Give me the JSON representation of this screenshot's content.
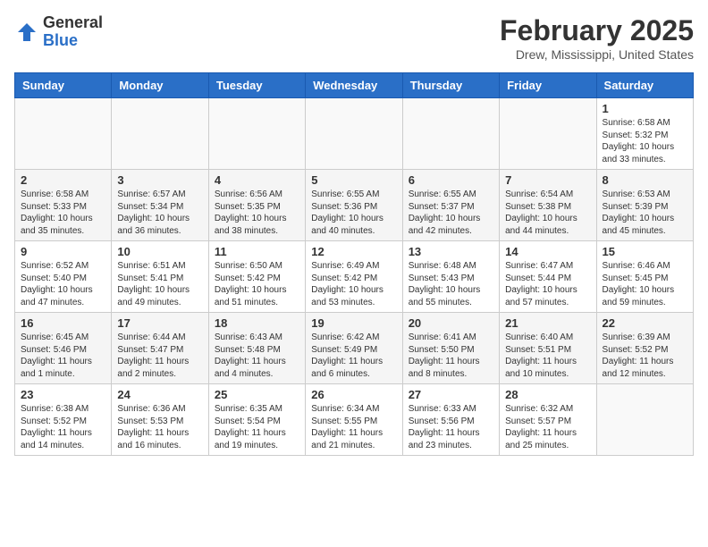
{
  "header": {
    "logo_general": "General",
    "logo_blue": "Blue",
    "title": "February 2025",
    "location": "Drew, Mississippi, United States"
  },
  "weekdays": [
    "Sunday",
    "Monday",
    "Tuesday",
    "Wednesday",
    "Thursday",
    "Friday",
    "Saturday"
  ],
  "weeks": [
    [
      {
        "day": "",
        "info": ""
      },
      {
        "day": "",
        "info": ""
      },
      {
        "day": "",
        "info": ""
      },
      {
        "day": "",
        "info": ""
      },
      {
        "day": "",
        "info": ""
      },
      {
        "day": "",
        "info": ""
      },
      {
        "day": "1",
        "info": "Sunrise: 6:58 AM\nSunset: 5:32 PM\nDaylight: 10 hours and 33 minutes."
      }
    ],
    [
      {
        "day": "2",
        "info": "Sunrise: 6:58 AM\nSunset: 5:33 PM\nDaylight: 10 hours and 35 minutes."
      },
      {
        "day": "3",
        "info": "Sunrise: 6:57 AM\nSunset: 5:34 PM\nDaylight: 10 hours and 36 minutes."
      },
      {
        "day": "4",
        "info": "Sunrise: 6:56 AM\nSunset: 5:35 PM\nDaylight: 10 hours and 38 minutes."
      },
      {
        "day": "5",
        "info": "Sunrise: 6:55 AM\nSunset: 5:36 PM\nDaylight: 10 hours and 40 minutes."
      },
      {
        "day": "6",
        "info": "Sunrise: 6:55 AM\nSunset: 5:37 PM\nDaylight: 10 hours and 42 minutes."
      },
      {
        "day": "7",
        "info": "Sunrise: 6:54 AM\nSunset: 5:38 PM\nDaylight: 10 hours and 44 minutes."
      },
      {
        "day": "8",
        "info": "Sunrise: 6:53 AM\nSunset: 5:39 PM\nDaylight: 10 hours and 45 minutes."
      }
    ],
    [
      {
        "day": "9",
        "info": "Sunrise: 6:52 AM\nSunset: 5:40 PM\nDaylight: 10 hours and 47 minutes."
      },
      {
        "day": "10",
        "info": "Sunrise: 6:51 AM\nSunset: 5:41 PM\nDaylight: 10 hours and 49 minutes."
      },
      {
        "day": "11",
        "info": "Sunrise: 6:50 AM\nSunset: 5:42 PM\nDaylight: 10 hours and 51 minutes."
      },
      {
        "day": "12",
        "info": "Sunrise: 6:49 AM\nSunset: 5:42 PM\nDaylight: 10 hours and 53 minutes."
      },
      {
        "day": "13",
        "info": "Sunrise: 6:48 AM\nSunset: 5:43 PM\nDaylight: 10 hours and 55 minutes."
      },
      {
        "day": "14",
        "info": "Sunrise: 6:47 AM\nSunset: 5:44 PM\nDaylight: 10 hours and 57 minutes."
      },
      {
        "day": "15",
        "info": "Sunrise: 6:46 AM\nSunset: 5:45 PM\nDaylight: 10 hours and 59 minutes."
      }
    ],
    [
      {
        "day": "16",
        "info": "Sunrise: 6:45 AM\nSunset: 5:46 PM\nDaylight: 11 hours and 1 minute."
      },
      {
        "day": "17",
        "info": "Sunrise: 6:44 AM\nSunset: 5:47 PM\nDaylight: 11 hours and 2 minutes."
      },
      {
        "day": "18",
        "info": "Sunrise: 6:43 AM\nSunset: 5:48 PM\nDaylight: 11 hours and 4 minutes."
      },
      {
        "day": "19",
        "info": "Sunrise: 6:42 AM\nSunset: 5:49 PM\nDaylight: 11 hours and 6 minutes."
      },
      {
        "day": "20",
        "info": "Sunrise: 6:41 AM\nSunset: 5:50 PM\nDaylight: 11 hours and 8 minutes."
      },
      {
        "day": "21",
        "info": "Sunrise: 6:40 AM\nSunset: 5:51 PM\nDaylight: 11 hours and 10 minutes."
      },
      {
        "day": "22",
        "info": "Sunrise: 6:39 AM\nSunset: 5:52 PM\nDaylight: 11 hours and 12 minutes."
      }
    ],
    [
      {
        "day": "23",
        "info": "Sunrise: 6:38 AM\nSunset: 5:52 PM\nDaylight: 11 hours and 14 minutes."
      },
      {
        "day": "24",
        "info": "Sunrise: 6:36 AM\nSunset: 5:53 PM\nDaylight: 11 hours and 16 minutes."
      },
      {
        "day": "25",
        "info": "Sunrise: 6:35 AM\nSunset: 5:54 PM\nDaylight: 11 hours and 19 minutes."
      },
      {
        "day": "26",
        "info": "Sunrise: 6:34 AM\nSunset: 5:55 PM\nDaylight: 11 hours and 21 minutes."
      },
      {
        "day": "27",
        "info": "Sunrise: 6:33 AM\nSunset: 5:56 PM\nDaylight: 11 hours and 23 minutes."
      },
      {
        "day": "28",
        "info": "Sunrise: 6:32 AM\nSunset: 5:57 PM\nDaylight: 11 hours and 25 minutes."
      },
      {
        "day": "",
        "info": ""
      }
    ]
  ]
}
